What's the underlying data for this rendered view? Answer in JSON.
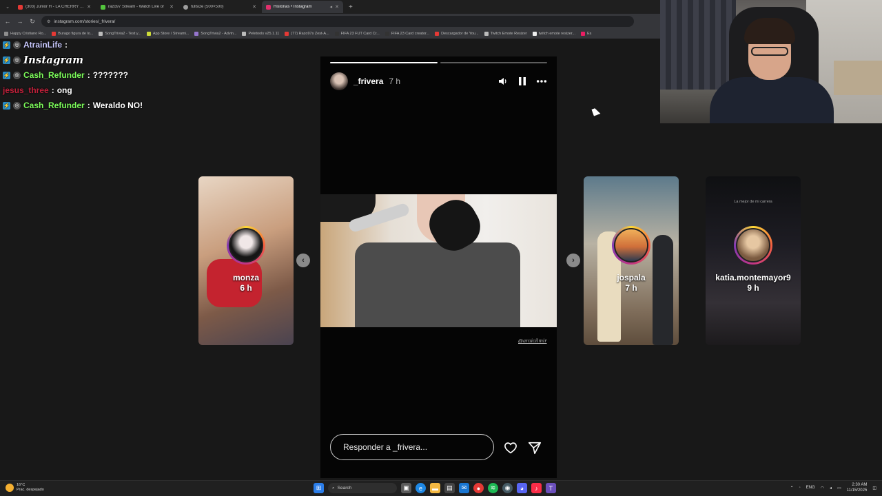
{
  "browser": {
    "tabs": [
      {
        "label": "(303) Junior H - LA CHERRY [Of",
        "color": "#e53935",
        "active": false
      },
      {
        "label": "razo97 Stream - Watch Live or",
        "color": "#53c53d",
        "active": false
      },
      {
        "label": "fullsize (500×500)",
        "color": "#9e9e9e",
        "active": false
      },
      {
        "label": "Historias • Instagram",
        "color": "#e1306c",
        "active": true
      }
    ],
    "new_tab": "+",
    "url": "instagram.com/stories/_frivera/",
    "bookmarks": [
      {
        "label": "Happy Cristiano Ro...",
        "color": "#8e8e8e"
      },
      {
        "label": "Burago figura de lo...",
        "color": "#e53935"
      },
      {
        "label": "SongTrivia2 - Test y...",
        "color": "#bbbbbb"
      },
      {
        "label": "App Store / Streami...",
        "color": "#cddc39"
      },
      {
        "label": "SongTrivia2 - Advin...",
        "color": "#9575cd"
      },
      {
        "label": "Peletools v25.1.11",
        "color": "#bbbbbb"
      },
      {
        "label": "(77) Razo97s Zest-A...",
        "color": "#e53935"
      },
      {
        "label": "FIFA 23 FUT Card Cr...",
        "color": "#333333"
      },
      {
        "label": "FIFA 23 Card creator...",
        "color": "#333333"
      },
      {
        "label": "Descargador de You...",
        "color": "#e53935"
      },
      {
        "label": "Twitch Emote Resizer",
        "color": "#bbbbbb"
      },
      {
        "label": "twitch emote resizer...",
        "color": "#eeeeee"
      },
      {
        "label": "Es",
        "color": "#e91e63"
      }
    ]
  },
  "chat": [
    {
      "user": "AtrainLife",
      "user_color": "#c9c9ff",
      "message": "",
      "badge": true
    },
    {
      "user": "",
      "user_color": "#ffffff",
      "message": "",
      "emote": "Instagram",
      "badge": true
    },
    {
      "user": "Cash_Refunder",
      "user_color": "#7cfc5a",
      "message": "???????",
      "badge": true
    },
    {
      "user": "jesus_three",
      "user_color": "#c0203a",
      "message": "ong",
      "badge": false
    },
    {
      "user": "Cash_Refunder",
      "user_color": "#7cfc5a",
      "message": "Weraldo NO!",
      "badge": true
    }
  ],
  "story": {
    "username": "_frivera",
    "time": "7 h",
    "progress": [
      1.0,
      0.0
    ],
    "watermark": "@araicilmir",
    "reply_placeholder": "Responder a _frivera..."
  },
  "thumbs": [
    {
      "name": "monza",
      "time": "6 h"
    },
    {
      "name": "jospala",
      "time": "7 h"
    },
    {
      "name": "katia.montemayor9",
      "time": "9 h",
      "caption": "La mejor de mi carrera"
    }
  ],
  "nav": {
    "prev": "‹",
    "next": "›"
  },
  "taskbar": {
    "weather_temp": "16°C",
    "weather_desc": "Prac. despejado",
    "search": "Search",
    "lang": "ENG",
    "time": "2:30 AM",
    "date": "11/15/2025"
  },
  "icons": {
    "mute": "speaker-icon",
    "pause": "pause-icon",
    "more": "more-icon",
    "like": "heart-icon",
    "send": "send-icon"
  }
}
